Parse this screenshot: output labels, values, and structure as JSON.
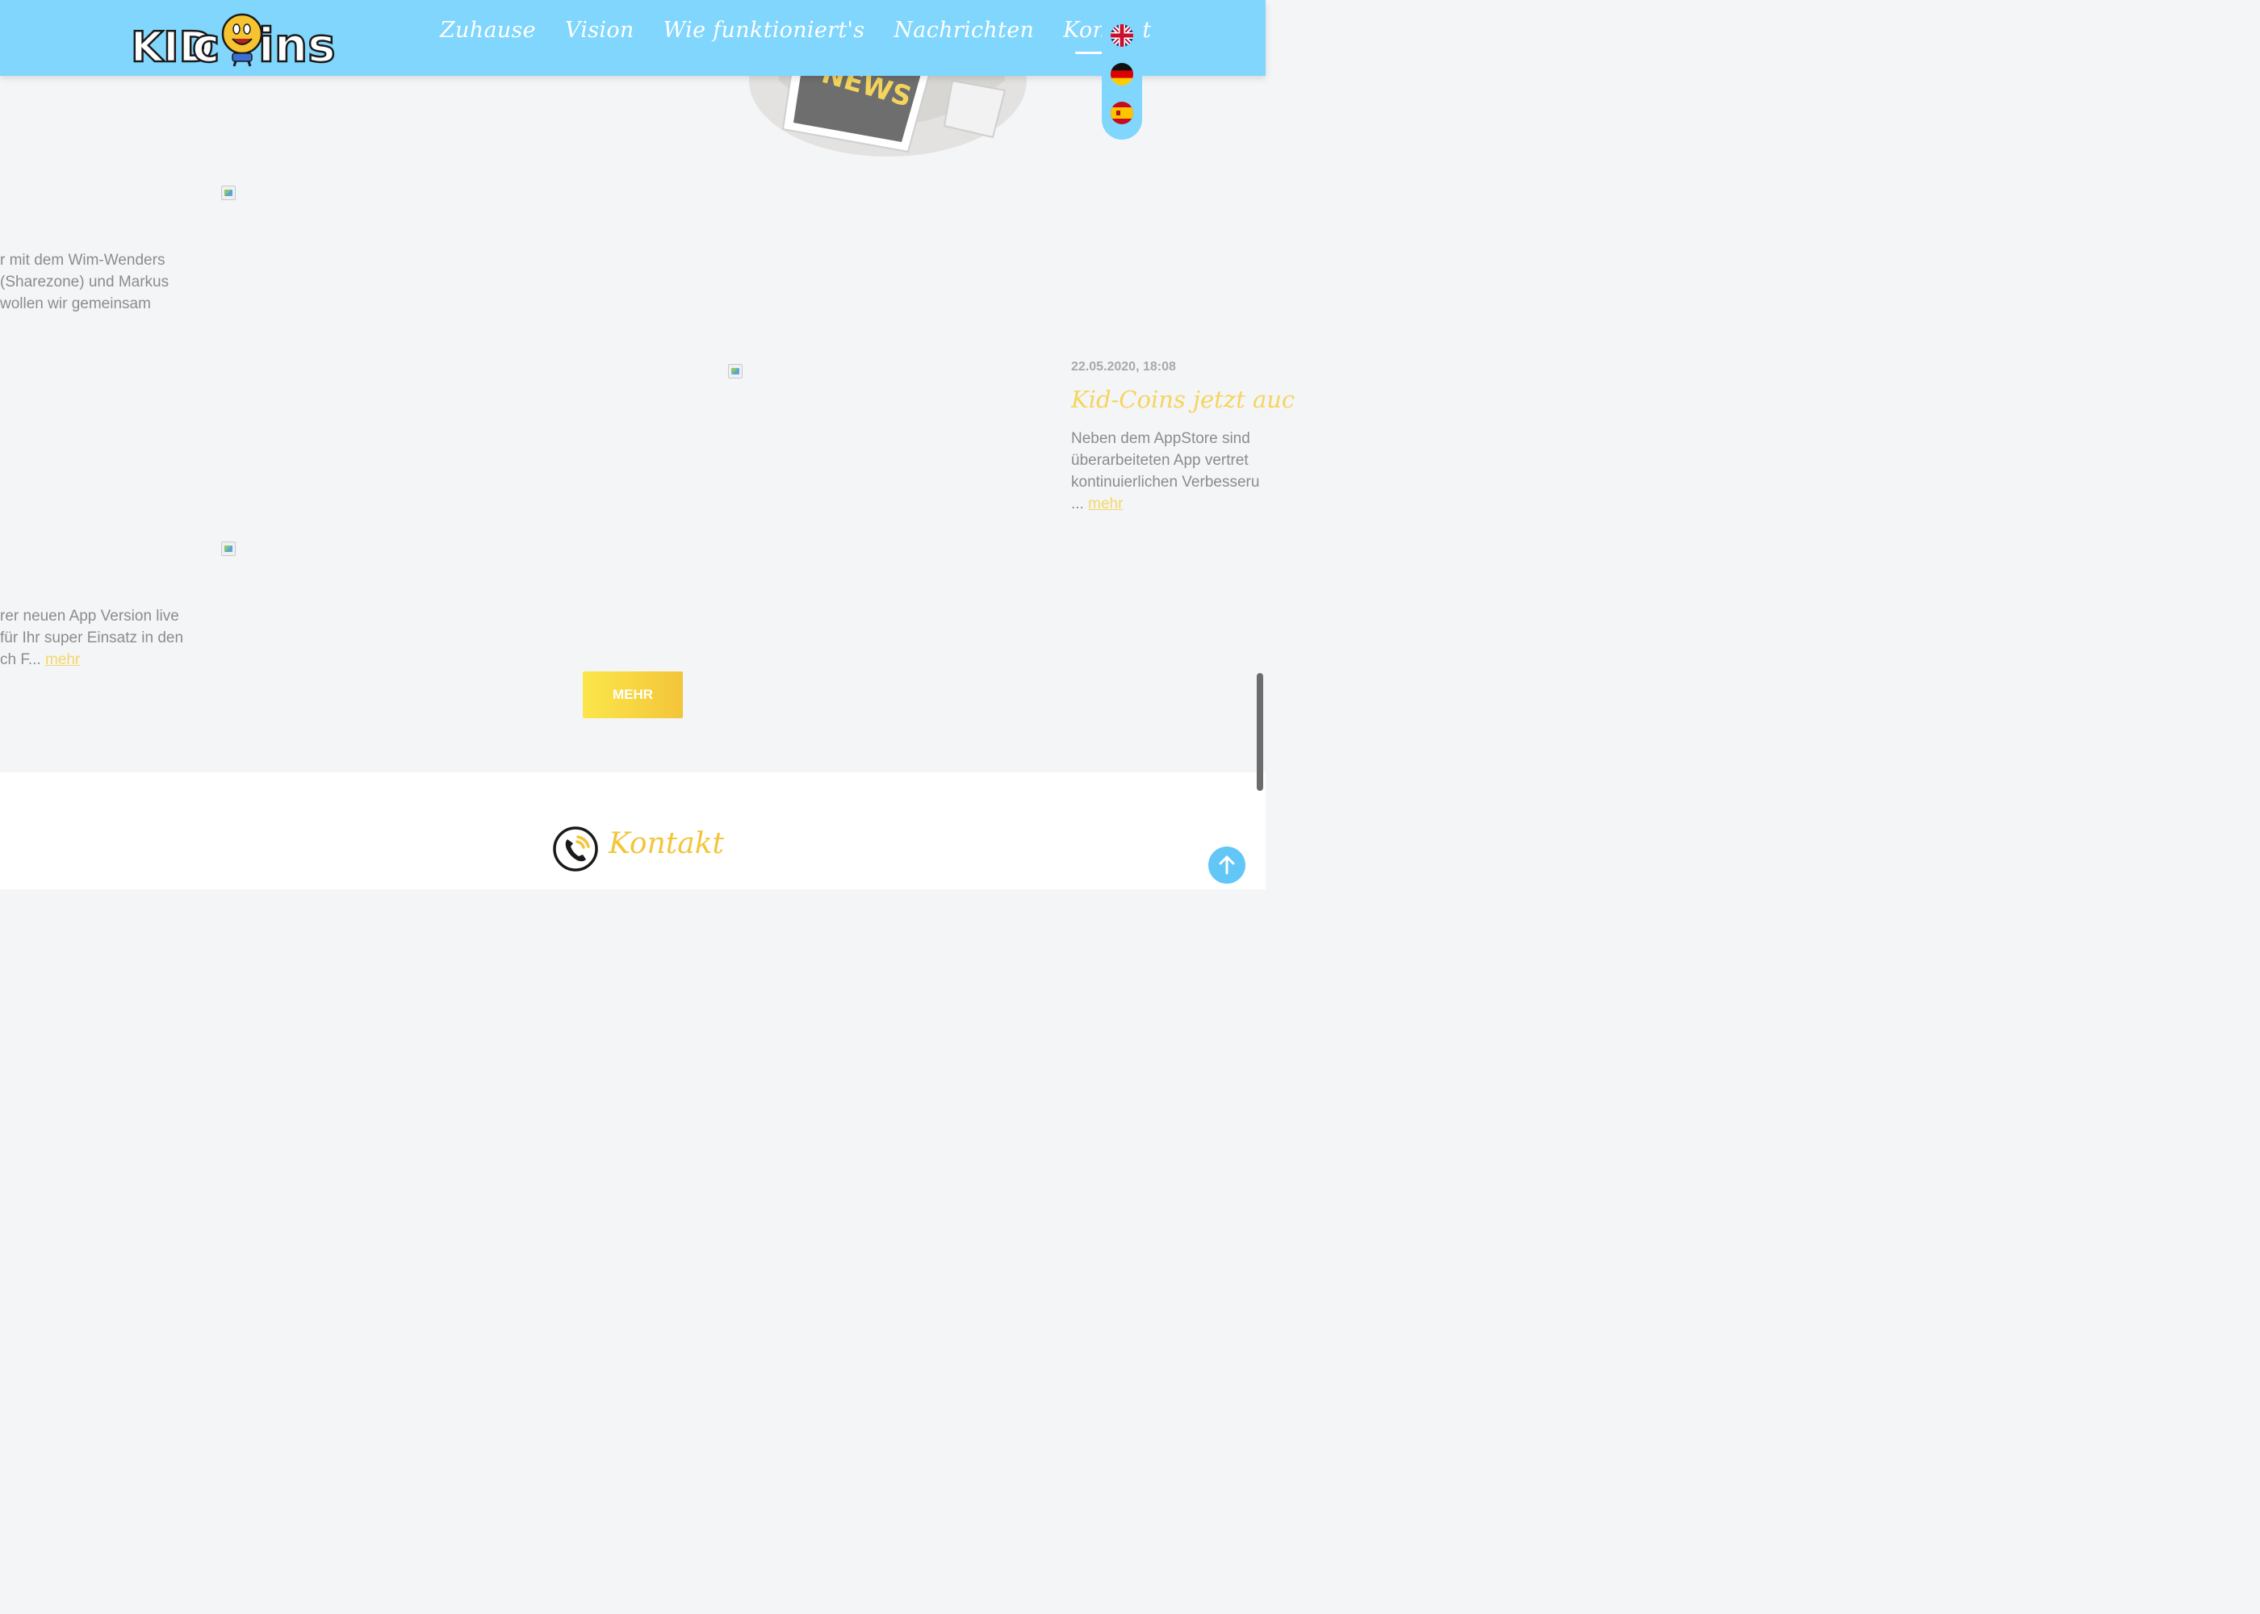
{
  "header": {
    "nav": [
      {
        "label": "Zuhause"
      },
      {
        "label": "Vision"
      },
      {
        "label": "Wie funktioniert's"
      },
      {
        "label": "Nachrichten"
      },
      {
        "label": "Kontakt",
        "active": true
      }
    ],
    "languages": [
      "english-flag-icon",
      "german-flag-icon",
      "spanish-flag-icon"
    ],
    "colors": {
      "header_bg": "#80d6fc",
      "accent_yellow": "#f3c53a",
      "link_yellow": "#f3d768"
    }
  },
  "articles": {
    "first": {
      "lines": [
        "r mit dem Wim-Wenders",
        "(Sharezone) und Markus",
        "wollen wir gemeinsam"
      ]
    },
    "second": {
      "date": "22.05.2020, 18:08",
      "title": "Kid-Coins jetzt auc",
      "lines": [
        "Neben dem AppStore sind",
        "überarbeiteten App vertret",
        "kontinuierlichen Verbesseru"
      ],
      "ellipsis": "...",
      "more": "mehr"
    },
    "third": {
      "lines": [
        "rer neuen App Version live",
        "für Ihr super Einsatz in den"
      ],
      "last_line": "ch F...",
      "more": "mehr"
    }
  },
  "mehr_button": "MEHR",
  "contact": {
    "title": "Kontakt",
    "icon": "phone-icon"
  },
  "back_to_top_icon": "arrow-up-icon"
}
